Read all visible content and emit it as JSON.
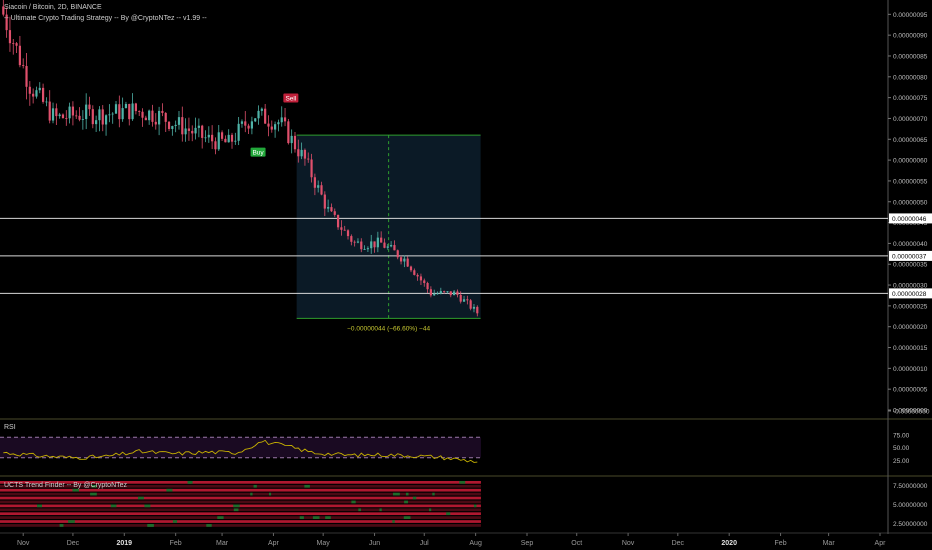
{
  "header": {
    "symbol_line": "Siacoin / Bitcoin, 2D, BINANCE",
    "strategy_line": "-- Ultimate Crypto Trading Strategy -- By @CryptoNTez -- v1.99 --"
  },
  "colors": {
    "background": "#000000",
    "candle_up": "#4fb3a8",
    "candle_down": "#e0506c",
    "measure_border": "#2e9e2e",
    "measure_fill": "#0b1a26",
    "measure_text": "#c8c832",
    "level_line": "#d8d8d8",
    "rsi_line": "#c8b200",
    "rsi_band": "#1a0a22",
    "buy": "#22a83a",
    "sell": "#c0203a"
  },
  "price_axis": {
    "labels": [
      "0.00000095",
      "0.00000090",
      "0.00000085",
      "0.00000080",
      "0.00000075",
      "0.00000070",
      "0.00000065",
      "0.00000060",
      "0.00000055",
      "0.00000050",
      "0.00000045",
      "0.00000040",
      "0.00000035",
      "0.00000030",
      "0.00000025",
      "0.00000020",
      "0.00000015",
      "0.00000010",
      "0.00000005",
      "0.00000000",
      "-0.00000000"
    ]
  },
  "levels": [
    {
      "label": "0.00000046"
    },
    {
      "label": "0.00000037"
    },
    {
      "label": "0.00000028"
    }
  ],
  "signals": {
    "buy_label": "Buy",
    "sell_label": "Sell"
  },
  "measurement": {
    "text": "−0.00000044 (−66.60%) −44"
  },
  "rsi_pane": {
    "title": "RSI",
    "axis_labels": [
      "75.00",
      "50.00",
      "25.00"
    ]
  },
  "ucts_pane": {
    "title": "UCTS Trend Finder -- By @CryptoNTez",
    "axis_labels": [
      "7.50000000",
      "5.00000000",
      "2.50000000"
    ]
  },
  "time_axis": {
    "labels": [
      "Nov",
      "Dec",
      "2019",
      "Feb",
      "Mar",
      "Apr",
      "May",
      "Jun",
      "Jul",
      "Aug",
      "Sep",
      "Oct",
      "Nov",
      "Dec",
      "2020",
      "Feb",
      "Mar",
      "Apr"
    ]
  },
  "chart_data": {
    "type": "candlestick",
    "title": "Siacoin / Bitcoin, 2D, BINANCE",
    "ylim": [
      0,
      9.7e-07
    ],
    "x_range": [
      "2018-10-18",
      "2020-04-01"
    ],
    "series": [
      {
        "name": "Siacoin / Bitcoin",
        "x": [
          "2018-10-20",
          "2018-11-05",
          "2018-11-20",
          "2018-12-05",
          "2018-12-20",
          "2019-01-05",
          "2019-01-20",
          "2019-02-05",
          "2019-02-20",
          "2019-03-05",
          "2019-03-20",
          "2019-04-05",
          "2019-04-20",
          "2019-05-05",
          "2019-05-20",
          "2019-06-05",
          "2019-06-20",
          "2019-07-05",
          "2019-07-20",
          "2019-08-03"
        ],
        "close": [
          9.5e-07,
          7.8e-07,
          7e-07,
          7.1e-07,
          7.1e-07,
          7.2e-07,
          7.1e-07,
          6.8e-07,
          6.5e-07,
          6.4e-07,
          7.1e-07,
          6.9e-07,
          6e-07,
          4.7e-07,
          4e-07,
          4e-07,
          3.6e-07,
          2.8e-07,
          2.8e-07,
          2.3e-07
        ]
      }
    ],
    "levels": [
      4.6e-07,
      3.7e-07,
      2.8e-07
    ],
    "signals": [
      {
        "type": "Buy",
        "x": "2019-03-20"
      },
      {
        "type": "Sell",
        "x": "2019-04-10"
      }
    ],
    "measurement": {
      "from_x": "2019-04-15",
      "to_x": "2019-08-04",
      "high": 6.6e-07,
      "low": 2.2e-07,
      "change": -4.4e-07,
      "percent": -66.6,
      "ticks": -44
    },
    "rsi": {
      "ylim": [
        0,
        100
      ],
      "band": [
        30,
        70
      ],
      "x": [
        "2018-10-20",
        "2018-11-10",
        "2018-12-01",
        "2018-12-20",
        "2019-01-10",
        "2019-02-01",
        "2019-02-20",
        "2019-03-10",
        "2019-03-25",
        "2019-04-10",
        "2019-04-25",
        "2019-05-15",
        "2019-06-05",
        "2019-06-25",
        "2019-07-10",
        "2019-08-03"
      ],
      "values": [
        40,
        34,
        30,
        32,
        42,
        38,
        41,
        40,
        62,
        52,
        40,
        35,
        36,
        34,
        31,
        22
      ]
    }
  }
}
